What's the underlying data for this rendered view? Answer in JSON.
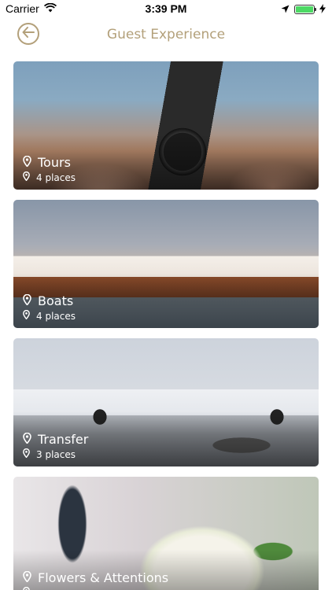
{
  "status_bar": {
    "carrier": "Carrier",
    "time": "3:39 PM",
    "battery_level": 1.0
  },
  "header": {
    "title": "Guest Experience",
    "back_icon": "arrow-left-icon",
    "accent_color": "#b3a07a"
  },
  "categories": [
    {
      "title": "Tours",
      "places": "4 places",
      "image": "camera-photo"
    },
    {
      "title": "Boats",
      "places": "4 places",
      "image": "yacht-photo"
    },
    {
      "title": "Transfer",
      "places": "3 places",
      "image": "jet-and-car-photo"
    },
    {
      "title": "Flowers & Attentions",
      "places": "",
      "image": "bouquet-photo"
    }
  ]
}
